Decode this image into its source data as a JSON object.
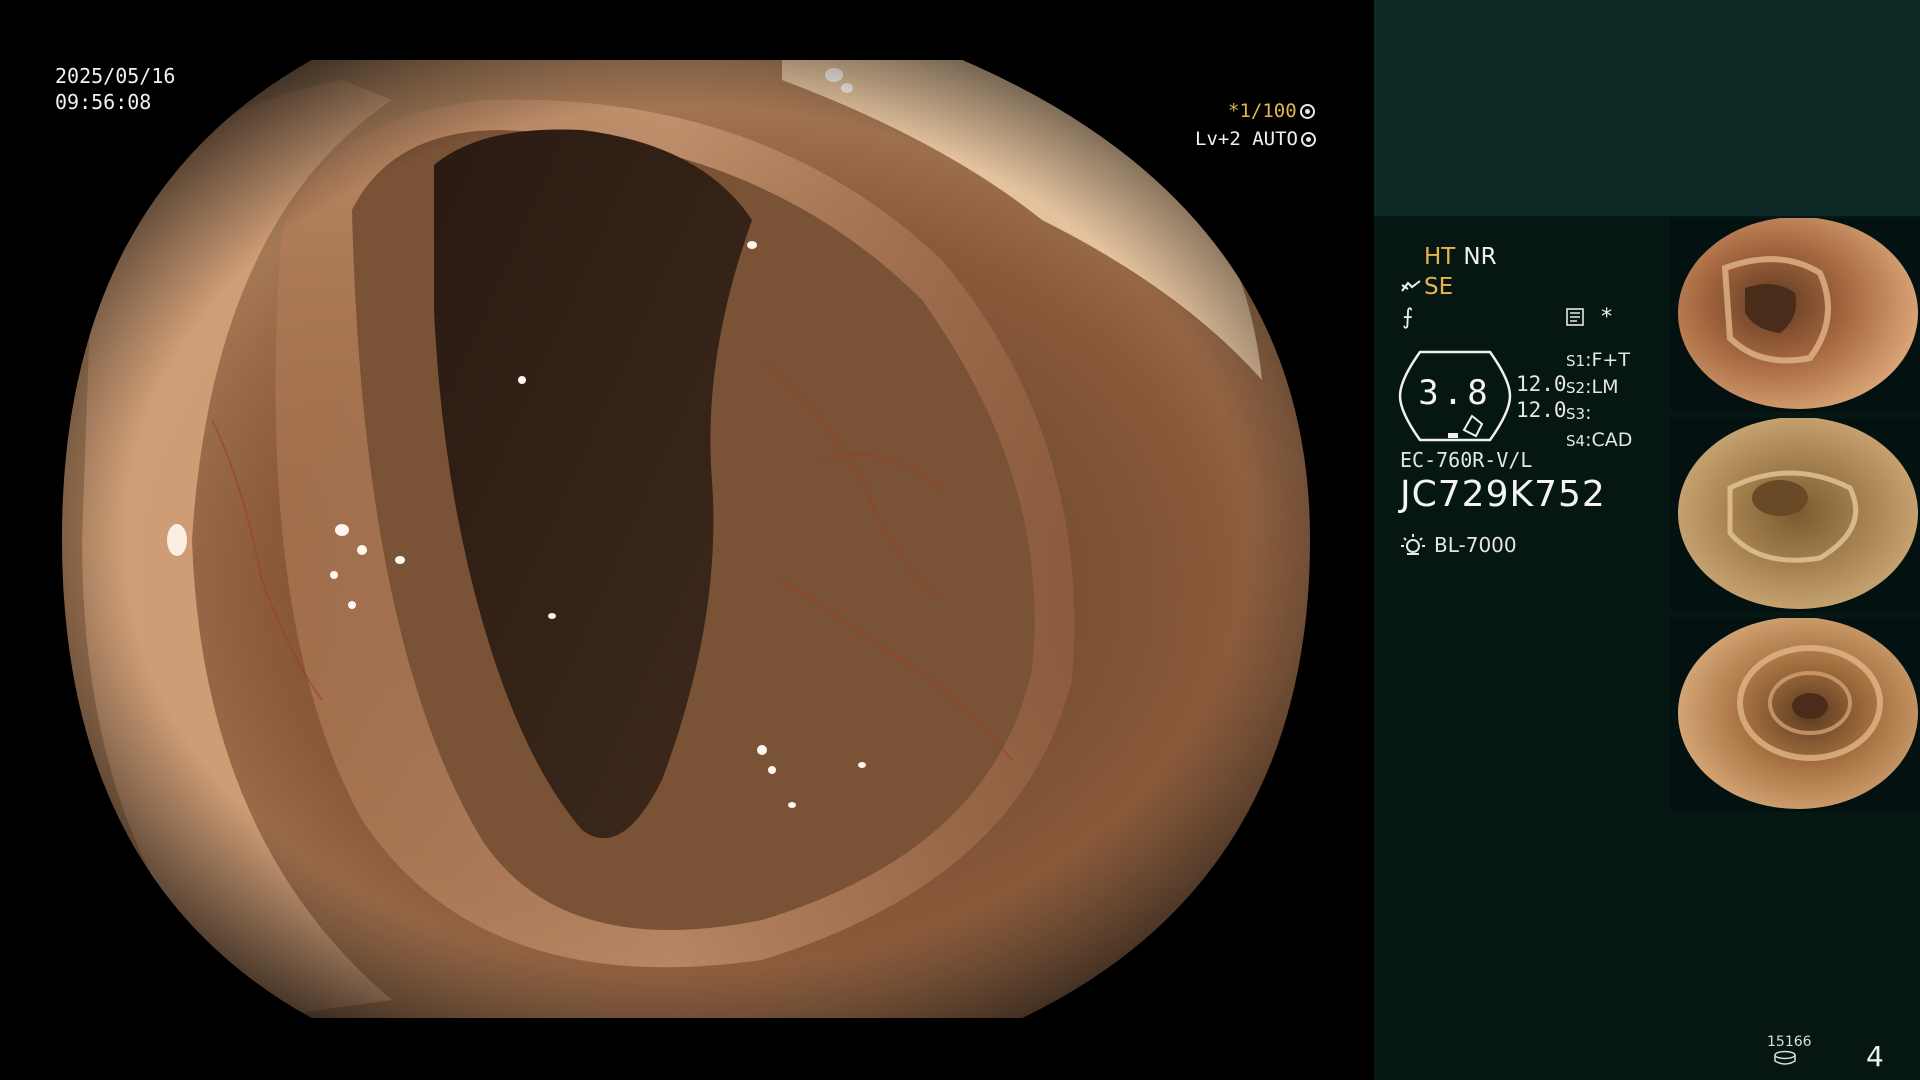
{
  "overlay": {
    "date": "2025/05/16",
    "time": "09:56:08",
    "shutter": "*1/100",
    "level": "Lv+2 AUTO"
  },
  "status": {
    "ht": "HT",
    "nr": "NR",
    "se": "SE",
    "asterisk": "*"
  },
  "gauge": {
    "value": "3.8",
    "num1": "12.0",
    "num2": "12.0"
  },
  "switches": [
    {
      "key": "S1",
      "value": "F+T"
    },
    {
      "key": "S2",
      "value": "LM"
    },
    {
      "key": "S3",
      "value": ""
    },
    {
      "key": "S4",
      "value": "CAD"
    }
  ],
  "scope": {
    "model": "EC-760R-V/L",
    "serial": "JC729K752",
    "light_source": "BL-7000"
  },
  "footer": {
    "counter": "15166",
    "page": "4"
  },
  "colors": {
    "accent": "#e8b54a",
    "panel_bg": "#061613",
    "panel_top_bg": "#0e2a26"
  },
  "icons": [
    "shutter-icon",
    "auto-icon",
    "se-icon",
    "enhance-icon",
    "memo-icon",
    "lamp-icon",
    "disk-icon"
  ]
}
